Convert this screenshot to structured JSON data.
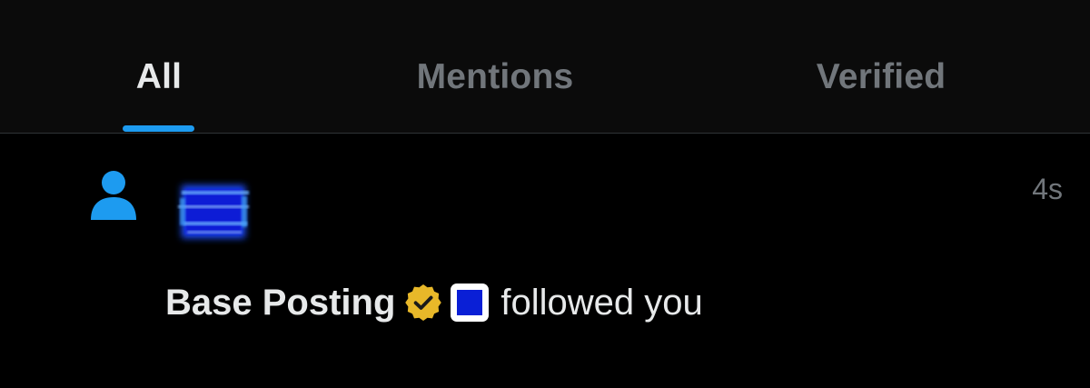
{
  "tabs": [
    {
      "label": "All",
      "active": true
    },
    {
      "label": "Mentions",
      "active": false
    },
    {
      "label": "Verified",
      "active": false
    }
  ],
  "colors": {
    "accent": "#1d9bf0",
    "background": "#000000",
    "tab_bar_background": "#0b0b0b",
    "inactive_text": "#71767b",
    "primary_text": "#e7e9ea",
    "verified_badge": "#e8b829",
    "square_emoji": "#0a1fd6"
  },
  "notification": {
    "type_icon": "person-icon",
    "avatar_icon": "blurred-blue-square-avatar",
    "timestamp": "4s",
    "user_name": "Base Posting",
    "badge_icon": "verified-gold-badge-icon",
    "emoji_icon": "blue-square-emoji-icon",
    "action": "followed you"
  }
}
